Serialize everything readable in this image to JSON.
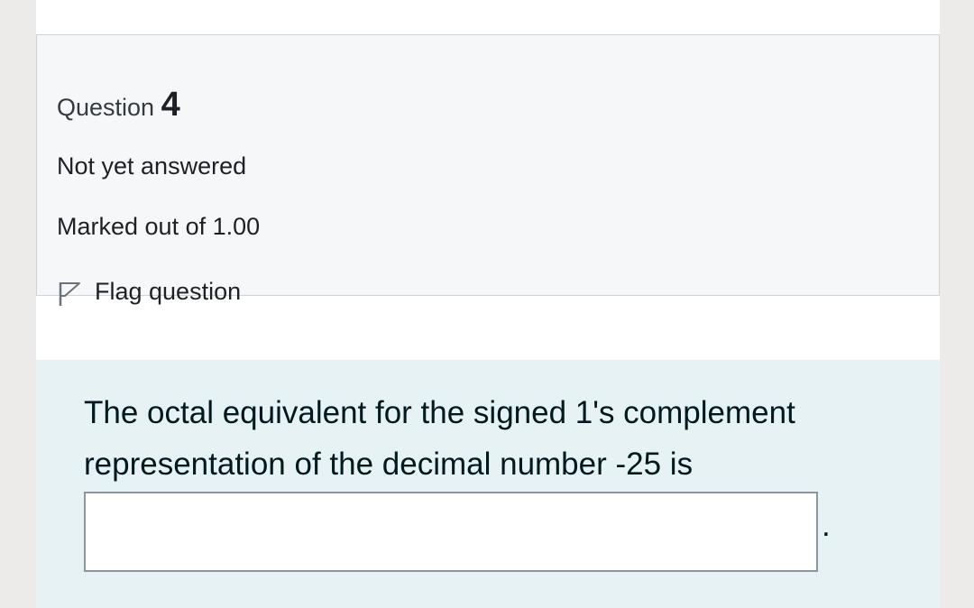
{
  "question": {
    "label": "Question",
    "number": "4",
    "state": "Not yet answered",
    "grade": "Marked out of 1.00",
    "flag_label": "Flag question",
    "flag_icon": "flag-outline-icon",
    "text": "The octal equivalent for the signed 1's complement representation of the decimal number -25 is",
    "answer_value": "",
    "answer_suffix": "."
  },
  "colors": {
    "page_background": "#ecebe9",
    "info_background": "#f6f7f9",
    "content_background": "#e7f2f4"
  }
}
